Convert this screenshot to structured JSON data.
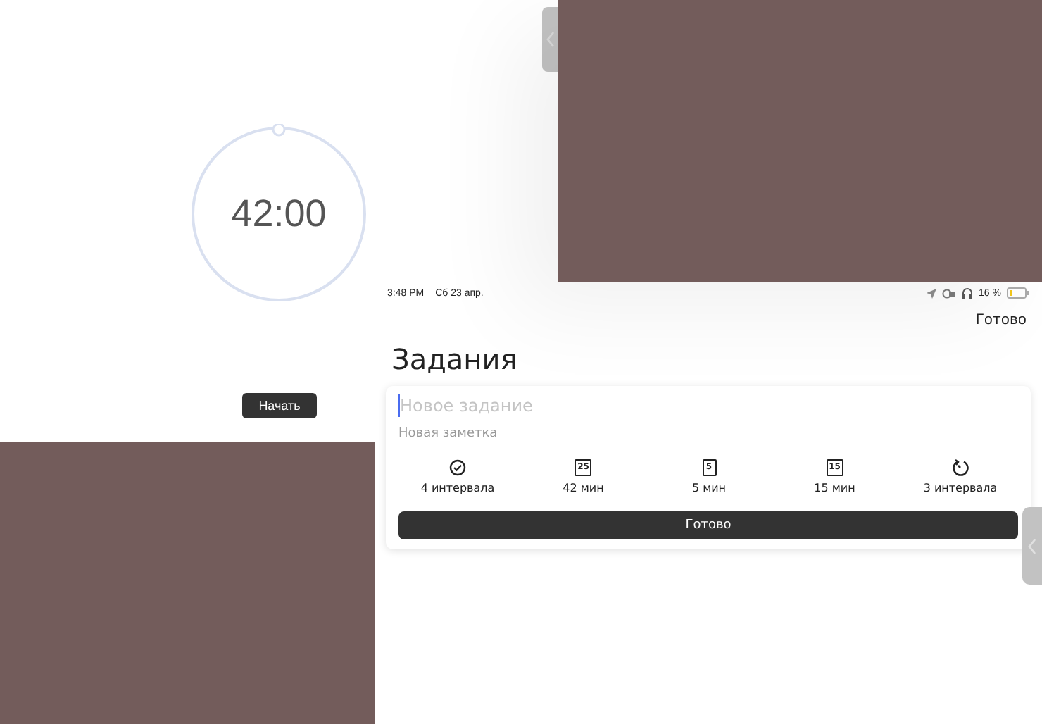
{
  "timer": {
    "time": "42:00"
  },
  "start_button": "Начать",
  "status_bar": {
    "time": "3:48 PM",
    "date": "Сб 23 апр.",
    "battery": "16 %"
  },
  "done_link": "Готово",
  "title": "Задания",
  "task_field": {
    "placeholder": "Новое задание"
  },
  "note_field": {
    "placeholder": "Новая заметка"
  },
  "settings": [
    {
      "kind": "check",
      "label": "4 интервала"
    },
    {
      "kind": "number",
      "badge": "25",
      "label": "42 мин"
    },
    {
      "kind": "number",
      "badge": "5",
      "label": "5 мин"
    },
    {
      "kind": "number",
      "badge": "15",
      "label": "15 мин"
    },
    {
      "kind": "repeat",
      "label": "3 интервала"
    }
  ],
  "done_button": "Готово"
}
